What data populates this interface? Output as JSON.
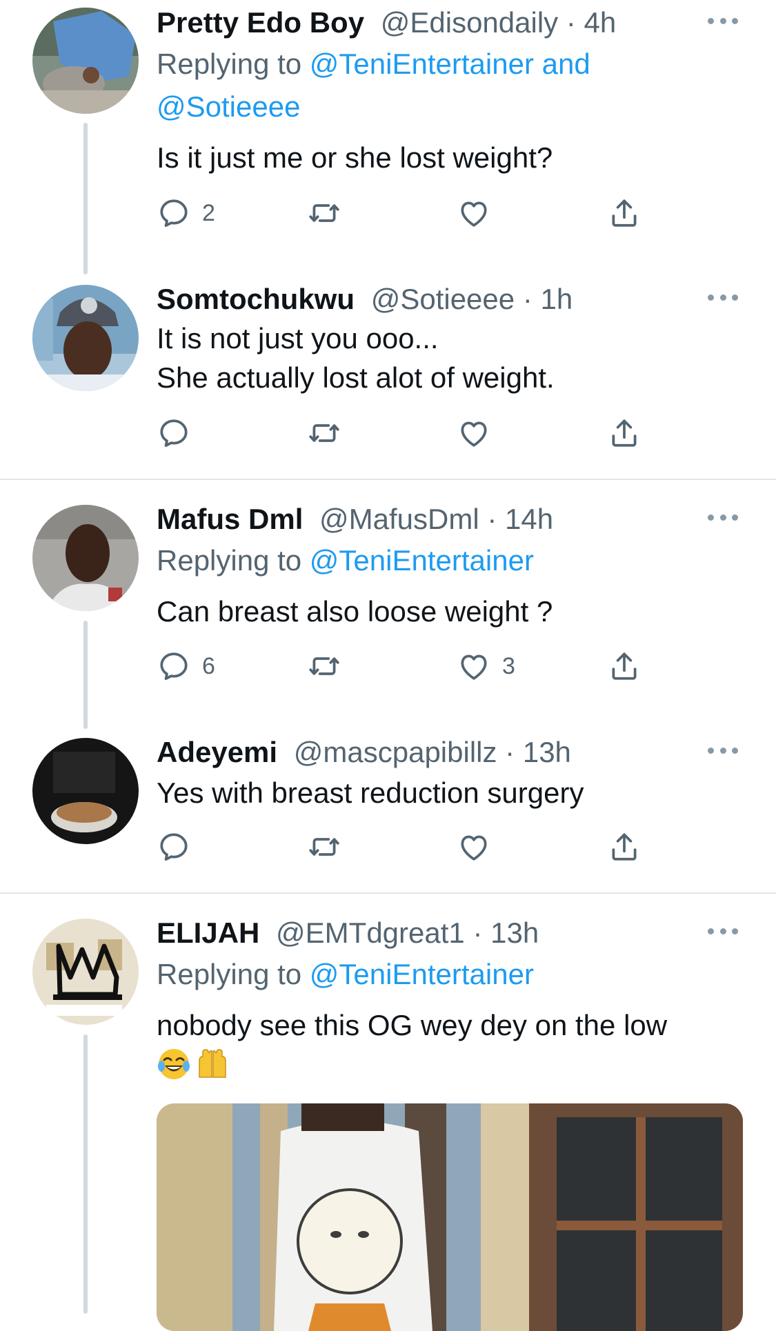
{
  "tweets": [
    {
      "name": "Pretty Edo Boy",
      "handle": "@Edisondaily",
      "time": "4h",
      "replying_prefix": "Replying to",
      "replying_line1": "@TeniEntertainer and",
      "replying_line2": "@Sotieeee",
      "text": "Is it just me or she lost weight?",
      "reply_count": "2",
      "like_count": ""
    },
    {
      "name": "Somtochukwu",
      "handle": "@Sotieeee",
      "time": "1h",
      "text_line1": "It is not just you ooo...",
      "text_line2": "She actually lost alot of weight."
    },
    {
      "name": "Mafus Dml",
      "handle": "@MafusDml",
      "time": "14h",
      "replying_prefix": "Replying to",
      "replying_to": "@TeniEntertainer",
      "text": "Can breast also loose weight ?",
      "reply_count": "6",
      "like_count": "3"
    },
    {
      "name": "Adeyemi",
      "handle": "@mascpapibillz",
      "time": "13h",
      "text": "Yes with breast reduction surgery"
    },
    {
      "name": "ELIJAH",
      "handle": "@EMTdgreat1",
      "time": "13h",
      "replying_prefix": "Replying to",
      "replying_to": "@TeniEntertainer",
      "text": "nobody see this OG wey dey on the low"
    }
  ],
  "separator": "·",
  "icons": [
    "reply-icon",
    "retweet-icon",
    "like-icon",
    "share-icon",
    "more-icon"
  ],
  "colors": {
    "link": "#1d9bf0",
    "secondary_text": "#536471",
    "icon": "#536471",
    "divider": "#e1e6ea",
    "thread_line": "#cfd9de"
  }
}
